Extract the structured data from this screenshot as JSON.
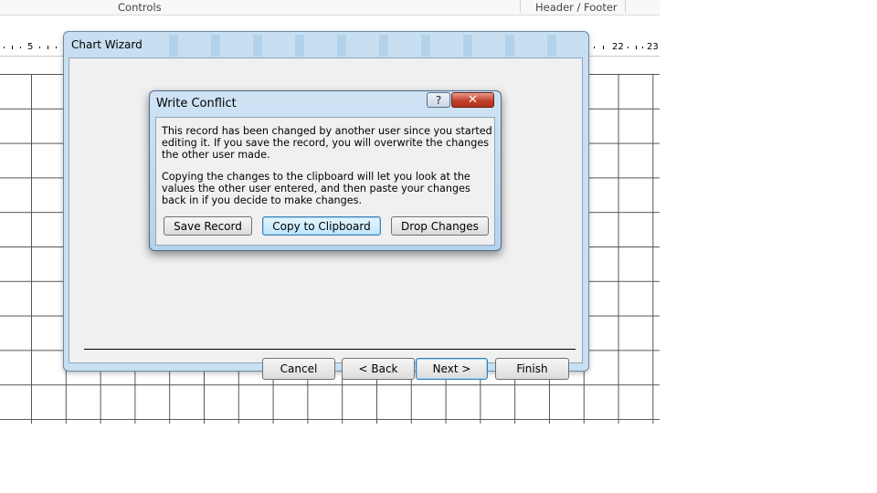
{
  "ribbon": {
    "controls_label": "Controls",
    "header_footer_label": "Header / Footer"
  },
  "ruler": {
    "marks": [
      "5",
      "22",
      "23"
    ]
  },
  "chart_wizard": {
    "title": "Chart Wizard",
    "buttons": {
      "cancel": "Cancel",
      "back": "< Back",
      "next": "Next >",
      "finish": "Finish"
    }
  },
  "write_conflict": {
    "title": "Write Conflict",
    "help_glyph": "?",
    "close_glyph": "✕",
    "message_1": "This record has been changed by another user since you started editing it.  If you save the record, you will overwrite the changes the other user made.",
    "message_2": "Copying the changes to the clipboard will let you look at the values the other user entered, and then paste your changes back in if you decide to make changes.",
    "buttons": {
      "save_record": "Save Record",
      "copy_to_clipboard": "Copy to Clipboard",
      "drop_changes": "Drop Changes"
    }
  }
}
